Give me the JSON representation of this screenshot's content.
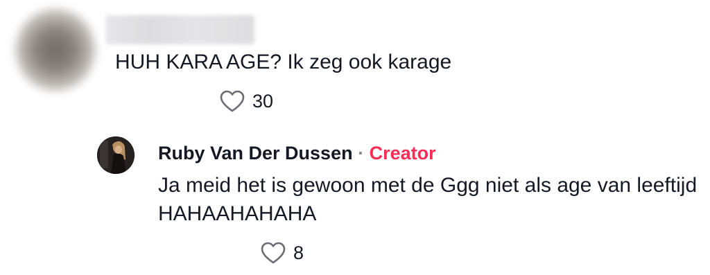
{
  "comment": {
    "text": "HUH KARA AGE? Ik zeg ook karage",
    "likes": "30",
    "like_icon": "heart-outline-icon"
  },
  "reply": {
    "author": "Ruby Van Der Dussen",
    "separator": "·",
    "role": "Creator",
    "role_color": "#fe2c55",
    "text": "Ja meid het is gewoon met de Ggg niet als age van leeftijd HAHAAHAHAHA",
    "likes": "8",
    "like_icon": "heart-outline-icon"
  }
}
